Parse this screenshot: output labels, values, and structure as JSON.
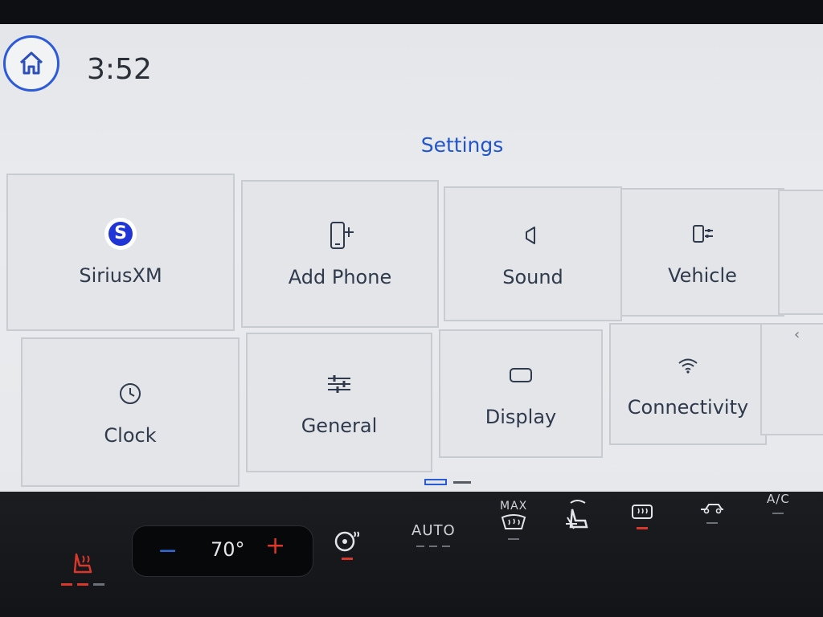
{
  "status": {
    "time": "3:52"
  },
  "page": {
    "title": "Settings"
  },
  "tiles": [
    {
      "label": "SiriusXM",
      "icon": "siriusxm-logo-icon"
    },
    {
      "label": "Add Phone",
      "icon": "add-phone-icon"
    },
    {
      "label": "Sound",
      "icon": "speaker-icon"
    },
    {
      "label": "Vehicle",
      "icon": "vehicle-settings-icon"
    },
    {
      "label": "Clock",
      "icon": "clock-icon"
    },
    {
      "label": "General",
      "icon": "sliders-icon"
    },
    {
      "label": "Display",
      "icon": "display-icon"
    },
    {
      "label": "Connectivity",
      "icon": "wifi-icon"
    }
  ],
  "sirius_logo_letter": "S",
  "pager": {
    "pages": 2,
    "current": 1
  },
  "side_arrow": "‹",
  "climate": {
    "minus": "−",
    "temperature": "70°",
    "plus": "+",
    "auto_label": "AUTO",
    "max_label": "MAX",
    "ac_label": "A/C",
    "colors": {
      "heat": "#d8382b",
      "cool": "#2f6ad8"
    }
  }
}
